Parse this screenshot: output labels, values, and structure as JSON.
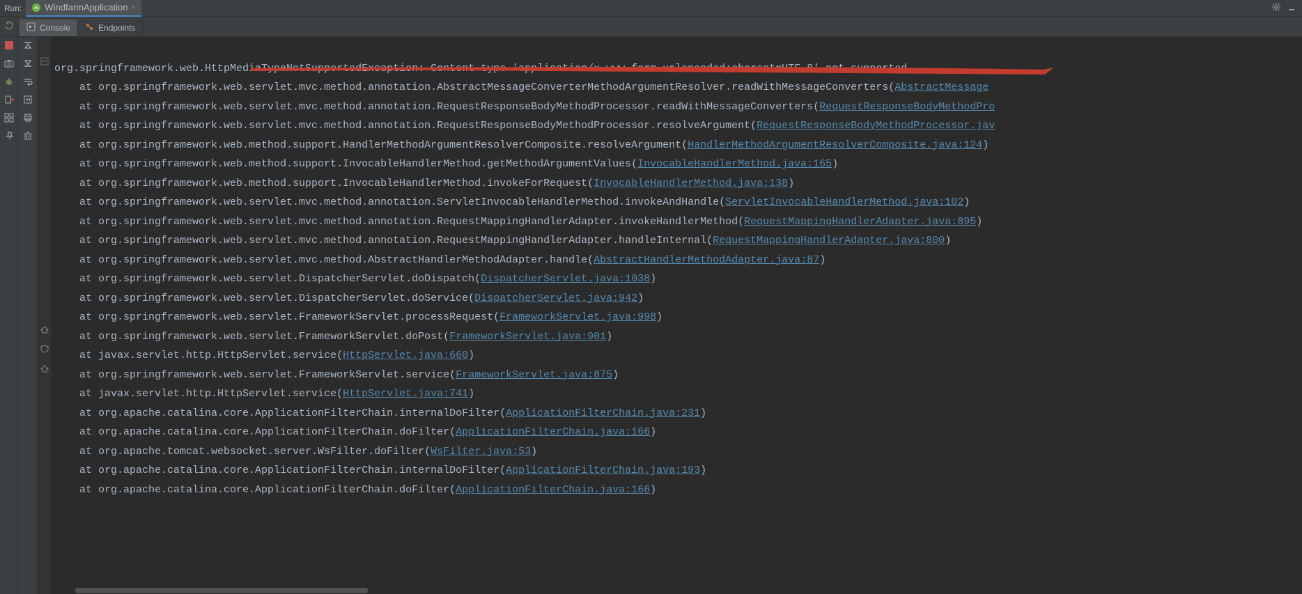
{
  "header": {
    "run_label": "Run:",
    "tab_label": "WindfarmApplication"
  },
  "subtabs": {
    "console": "Console",
    "endpoints": "Endpoints"
  },
  "exception_line": "org.springframework.web.HttpMediaTypeNotSupportedException: Content type 'application/x-www-form-urlencoded;charset=UTF-8' not supported",
  "stack": [
    {
      "prefix": "    at org.springframework.web.servlet.mvc.method.annotation.AbstractMessageConverterMethodArgumentResolver.readWithMessageConverters(",
      "link": "AbstractMessage",
      "suffix": ""
    },
    {
      "prefix": "    at org.springframework.web.servlet.mvc.method.annotation.RequestResponseBodyMethodProcessor.readWithMessageConverters(",
      "link": "RequestResponseBodyMethodPro",
      "suffix": ""
    },
    {
      "prefix": "    at org.springframework.web.servlet.mvc.method.annotation.RequestResponseBodyMethodProcessor.resolveArgument(",
      "link": "RequestResponseBodyMethodProcessor.jav",
      "suffix": ""
    },
    {
      "prefix": "    at org.springframework.web.method.support.HandlerMethodArgumentResolverComposite.resolveArgument(",
      "link": "HandlerMethodArgumentResolverComposite.java:124",
      "suffix": ")"
    },
    {
      "prefix": "    at org.springframework.web.method.support.InvocableHandlerMethod.getMethodArgumentValues(",
      "link": "InvocableHandlerMethod.java:165",
      "suffix": ")"
    },
    {
      "prefix": "    at org.springframework.web.method.support.InvocableHandlerMethod.invokeForRequest(",
      "link": "InvocableHandlerMethod.java:138",
      "suffix": ")"
    },
    {
      "prefix": "    at org.springframework.web.servlet.mvc.method.annotation.ServletInvocableHandlerMethod.invokeAndHandle(",
      "link": "ServletInvocableHandlerMethod.java:102",
      "suffix": ")"
    },
    {
      "prefix": "    at org.springframework.web.servlet.mvc.method.annotation.RequestMappingHandlerAdapter.invokeHandlerMethod(",
      "link": "RequestMappingHandlerAdapter.java:895",
      "suffix": ")"
    },
    {
      "prefix": "    at org.springframework.web.servlet.mvc.method.annotation.RequestMappingHandlerAdapter.handleInternal(",
      "link": "RequestMappingHandlerAdapter.java:800",
      "suffix": ")"
    },
    {
      "prefix": "    at org.springframework.web.servlet.mvc.method.AbstractHandlerMethodAdapter.handle(",
      "link": "AbstractHandlerMethodAdapter.java:87",
      "suffix": ")"
    },
    {
      "prefix": "    at org.springframework.web.servlet.DispatcherServlet.doDispatch(",
      "link": "DispatcherServlet.java:1038",
      "suffix": ")"
    },
    {
      "prefix": "    at org.springframework.web.servlet.DispatcherServlet.doService(",
      "link": "DispatcherServlet.java:942",
      "suffix": ")"
    },
    {
      "prefix": "    at org.springframework.web.servlet.FrameworkServlet.processRequest(",
      "link": "FrameworkServlet.java:998",
      "suffix": ")"
    },
    {
      "prefix": "    at org.springframework.web.servlet.FrameworkServlet.doPost(",
      "link": "FrameworkServlet.java:901",
      "suffix": ")"
    },
    {
      "prefix": "    at javax.servlet.http.HttpServlet.service(",
      "link": "HttpServlet.java:660",
      "suffix": ")"
    },
    {
      "prefix": "    at org.springframework.web.servlet.FrameworkServlet.service(",
      "link": "FrameworkServlet.java:875",
      "suffix": ")"
    },
    {
      "prefix": "    at javax.servlet.http.HttpServlet.service(",
      "link": "HttpServlet.java:741",
      "suffix": ")"
    },
    {
      "prefix": "    at org.apache.catalina.core.ApplicationFilterChain.internalDoFilter(",
      "link": "ApplicationFilterChain.java:231",
      "suffix": ")"
    },
    {
      "prefix": "    at org.apache.catalina.core.ApplicationFilterChain.doFilter(",
      "link": "ApplicationFilterChain.java:166",
      "suffix": ")"
    },
    {
      "prefix": "    at org.apache.tomcat.websocket.server.WsFilter.doFilter(",
      "link": "WsFilter.java:53",
      "suffix": ")"
    },
    {
      "prefix": "    at org.apache.catalina.core.ApplicationFilterChain.internalDoFilter(",
      "link": "ApplicationFilterChain.java:193",
      "suffix": ")"
    },
    {
      "prefix": "    at org.apache.catalina.core.ApplicationFilterChain.doFilter(",
      "link": "ApplicationFilterChain.java:166",
      "suffix": ")"
    }
  ],
  "colors": {
    "link": "#548ab1",
    "annotation": "#c43b2f"
  }
}
